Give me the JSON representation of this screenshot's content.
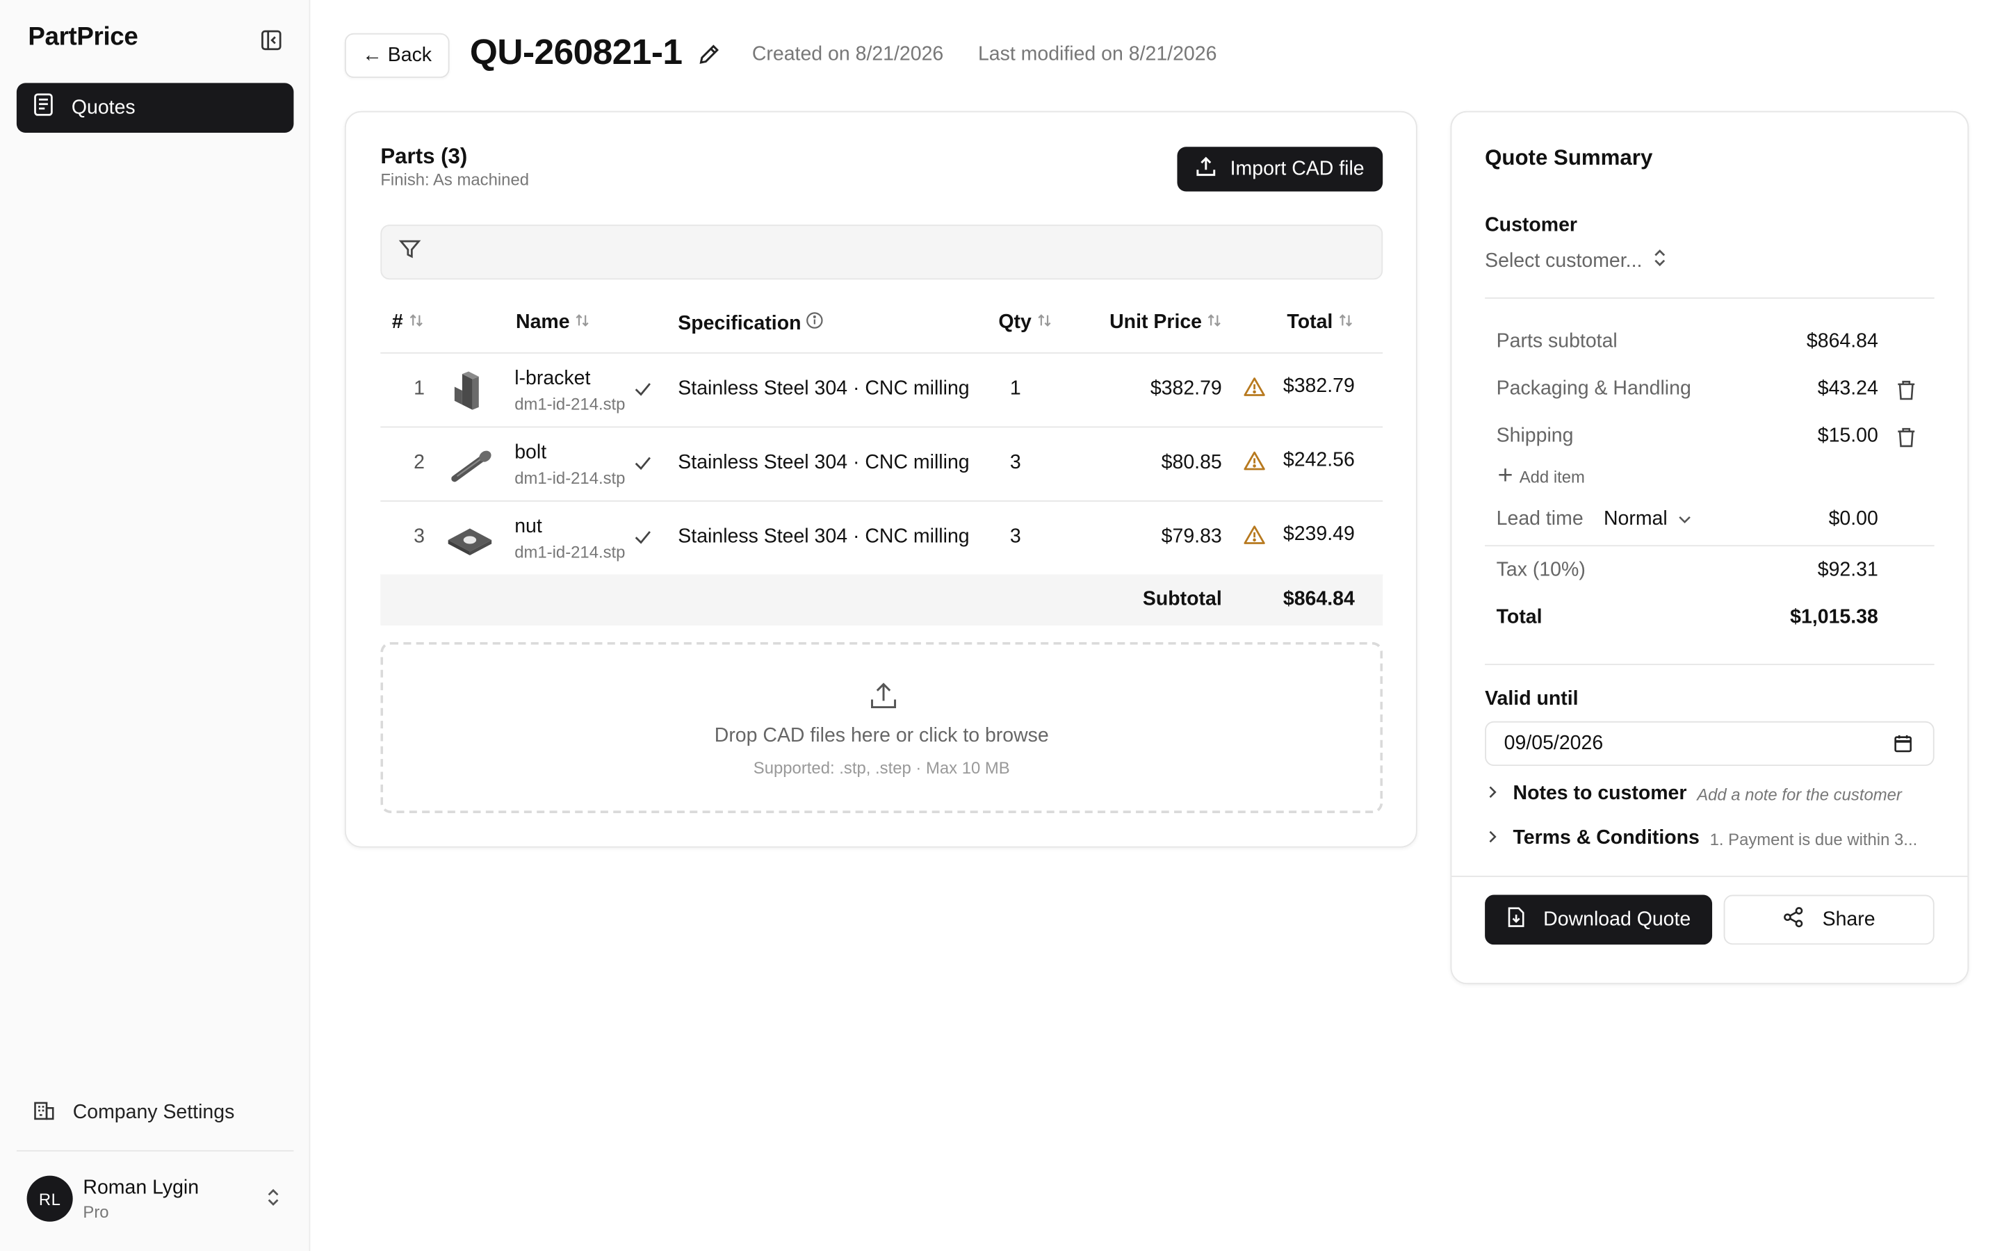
{
  "app": {
    "name": "PartPrice"
  },
  "sidebar": {
    "nav": [
      {
        "label": "Quotes",
        "icon": "document-icon",
        "active": true
      }
    ],
    "settings_label": "Company Settings",
    "user": {
      "initials": "RL",
      "name": "Roman Lygin",
      "plan": "Pro"
    }
  },
  "header": {
    "back_label": "← Back",
    "quote_id": "QU-260821-1",
    "created": "Created on 8/21/2026",
    "modified": "Last modified on 8/21/2026"
  },
  "parts": {
    "title": "Parts (3)",
    "finish": "Finish: As machined",
    "import_label": "Import CAD file",
    "columns": {
      "index": "#",
      "name": "Name",
      "spec": "Specification",
      "qty": "Qty",
      "unit_price": "Unit Price",
      "total": "Total"
    },
    "rows": [
      {
        "index": "1",
        "name": "l-bracket",
        "file": "dm1-id-214.stp",
        "spec": "Stainless Steel 304 · CNC milling",
        "qty": "1",
        "unit_price": "$382.79",
        "total": "$382.79",
        "thumb": "bracket-icon"
      },
      {
        "index": "2",
        "name": "bolt",
        "file": "dm1-id-214.stp",
        "spec": "Stainless Steel 304 · CNC milling",
        "qty": "3",
        "unit_price": "$80.85",
        "total": "$242.56",
        "thumb": "bolt-icon"
      },
      {
        "index": "3",
        "name": "nut",
        "file": "dm1-id-214.stp",
        "spec": "Stainless Steel 304 · CNC milling",
        "qty": "3",
        "unit_price": "$79.83",
        "total": "$239.49",
        "thumb": "nut-icon"
      }
    ],
    "subtotal_label": "Subtotal",
    "subtotal_value": "$864.84",
    "dropzone": {
      "text": "Drop CAD files here or click to browse",
      "sub": "Supported: .stp, .step · Max 10 MB"
    }
  },
  "summary": {
    "title": "Quote Summary",
    "customer_label": "Customer",
    "customer_placeholder": "Select customer...",
    "parts_subtotal_label": "Parts subtotal",
    "parts_subtotal_value": "$864.84",
    "packaging_label": "Packaging & Handling",
    "packaging_value": "$43.24",
    "shipping_label": "Shipping",
    "shipping_value": "$15.00",
    "add_item_label": "Add item",
    "lead_time_label": "Lead time",
    "lead_time_value": "Normal",
    "lead_time_cost": "$0.00",
    "tax_label": "Tax (10%)",
    "tax_value": "$92.31",
    "total_label": "Total",
    "total_value": "$1,015.38",
    "valid_label": "Valid until",
    "valid_value": "09/05/2026",
    "notes_label": "Notes to customer",
    "notes_placeholder": "Add a note for the customer",
    "terms_label": "Terms & Conditions",
    "terms_preview": "1. Payment is due within 3...",
    "download_label": "Download Quote",
    "share_label": "Share"
  },
  "colors": {
    "primary": "#18181b",
    "warning": "#b7791f",
    "muted": "#777777",
    "border": "#e6e6e6"
  }
}
